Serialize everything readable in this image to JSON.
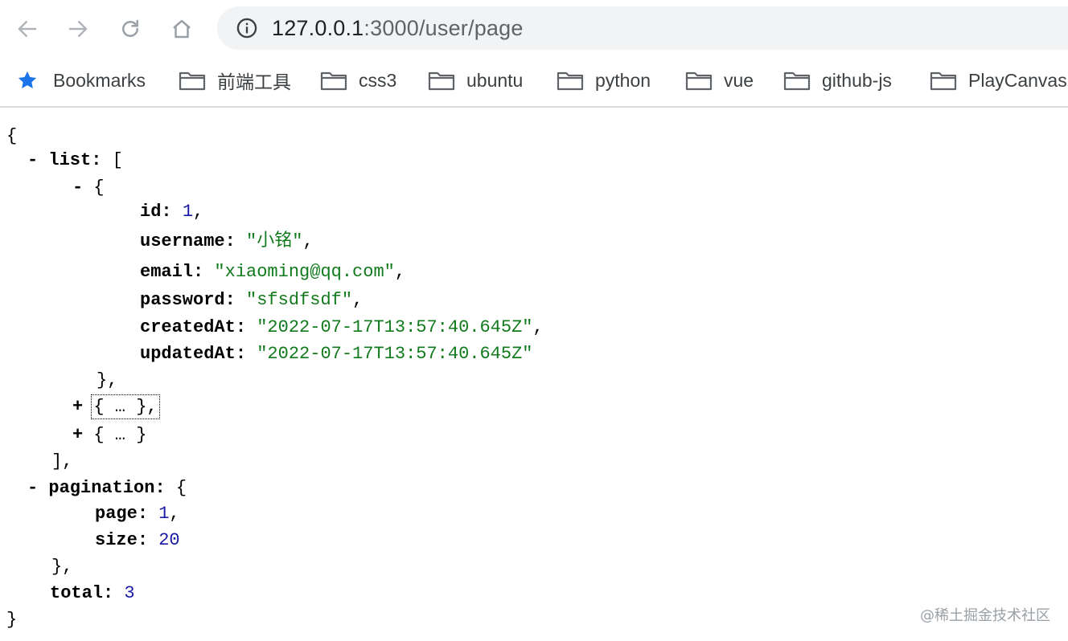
{
  "browser": {
    "url_host": "127.0.0.1",
    "url_port_path": ":3000/user/page"
  },
  "bookmarks": {
    "items": [
      {
        "label": "Bookmarks"
      },
      {
        "label": "前端工具"
      },
      {
        "label": "css3"
      },
      {
        "label": "ubuntu"
      },
      {
        "label": "python"
      },
      {
        "label": "vue"
      },
      {
        "label": "github-js"
      },
      {
        "label": "PlayCanvas"
      }
    ],
    "star_color": "#1a73e8"
  },
  "json": {
    "open_brace": "{",
    "close_brace": "}",
    "list_key": "list",
    "list_open": "[",
    "list_close": "],",
    "item_open": "{",
    "item_close": "},",
    "items": {
      "id_key": "id",
      "id_value": "1",
      "username_key": "username",
      "username_value": "\"小铭\"",
      "email_key": "email",
      "email_value": "\"xiaoming@qq.com\"",
      "password_key": "password",
      "password_value": "\"sfsdfsdf\"",
      "createdAt_key": "createdAt",
      "createdAt_value": "\"2022-07-17T13:57:40.645Z\"",
      "updatedAt_key": "updatedAt",
      "updatedAt_value": "\"2022-07-17T13:57:40.645Z\""
    },
    "collapsed_1": "{ … },",
    "collapsed_2": "{ … }",
    "pagination_key": "pagination",
    "pagination_open": "{",
    "pagination_close": "},",
    "page_key": "page",
    "page_value": "1",
    "size_key": "size",
    "size_value": "20",
    "total_key": "total",
    "total_value": "3",
    "expanded_toggle": "-",
    "collapsed_toggle": "+",
    "colors": {
      "string": "#117a1d",
      "number": "#1a1aa6"
    }
  },
  "watermark": "@稀土掘金技术社区"
}
